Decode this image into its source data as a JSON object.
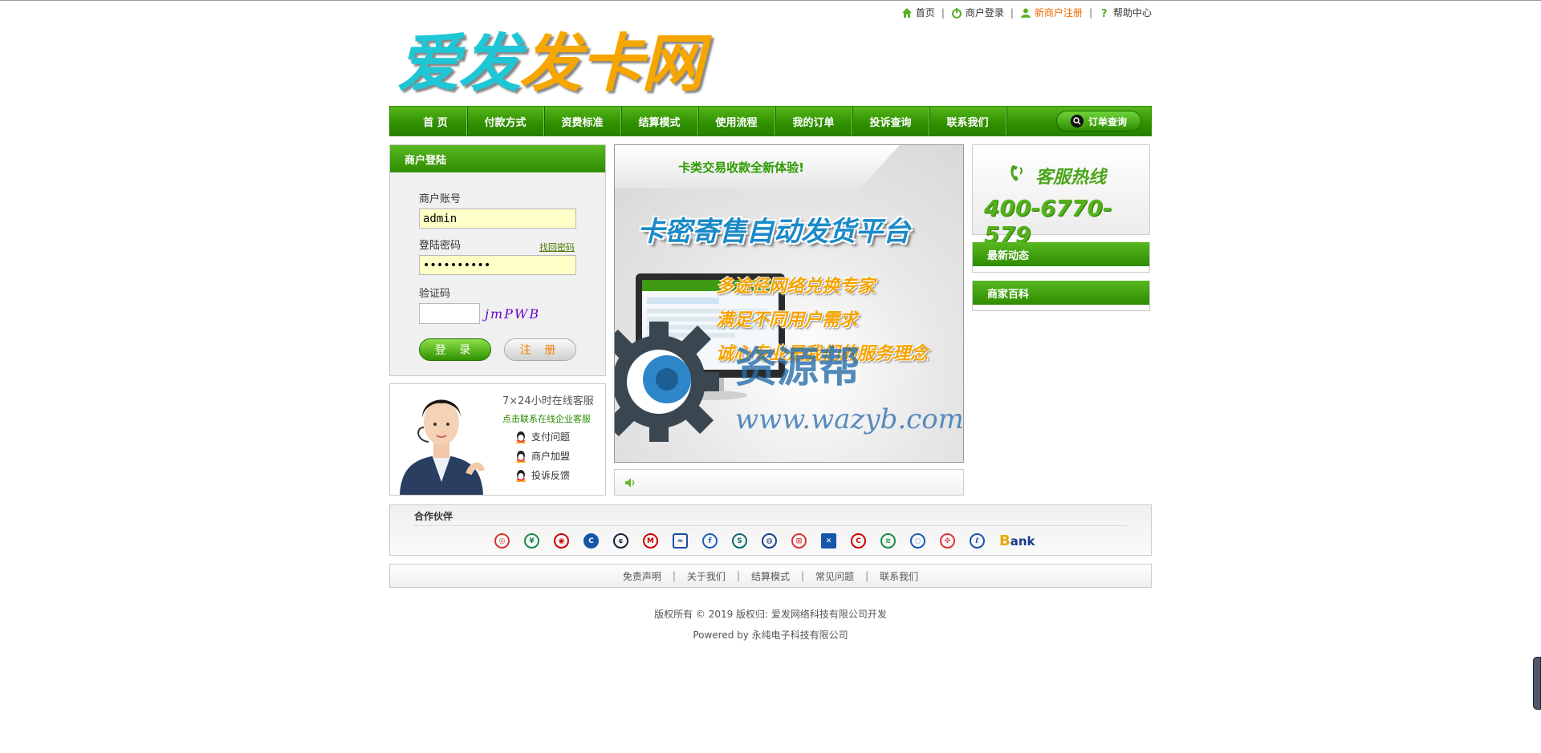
{
  "toplinks": {
    "home": "首页",
    "merchant_login": "商户登录",
    "new_register": "新商户注册",
    "help": "帮助中心"
  },
  "logo": {
    "part1": "爱发",
    "part2": "发卡网"
  },
  "nav": {
    "items": [
      "首 页",
      "付款方式",
      "资费标准",
      "结算模式",
      "使用流程",
      "我的订单",
      "投诉查询",
      "联系我们"
    ],
    "order_query": "订单查询"
  },
  "login": {
    "title": "商户登陆",
    "account_label": "商户账号",
    "account_value": "admin",
    "password_label": "登陆密码",
    "password_value": "••••••••••",
    "forgot": "找回密码",
    "captcha_label": "验证码",
    "captcha_text": "jmPWB",
    "login_btn": "登 录",
    "register_btn": "注 册"
  },
  "service": {
    "title": "7×24小时在线客服",
    "subtitle": "点击联系在线企业客服",
    "items": [
      "支付问题",
      "商户加盟",
      "投诉反馈"
    ]
  },
  "banner": {
    "tag": "卡类交易收款全新体验!",
    "headline": "卡密寄售自动发货平台",
    "lines": [
      "多途径网络兑换专家",
      "满足不同用户需求",
      "诚心专业是我们的服务理念"
    ],
    "watermark": "资源帮",
    "watermark_url": "www.wazyb.com"
  },
  "hotline": {
    "label": "客服热线",
    "number": "400-6770-579"
  },
  "sidebar": {
    "news": "最新动态",
    "wiki": "商家百科"
  },
  "partners": {
    "title": "合作伙伴",
    "bank_word": "Bank"
  },
  "footer": {
    "links": [
      "免责声明",
      "关于我们",
      "结算模式",
      "常见问题",
      "联系我们"
    ],
    "copyright": "版权所有 © 2019 版权归: 爱发网络科技有限公司开发",
    "powered": "Powered by 永纯电子科技有限公司"
  },
  "colors": {
    "green": "#2f8f00",
    "orange": "#f26b00",
    "blue": "#1a8ac8"
  }
}
